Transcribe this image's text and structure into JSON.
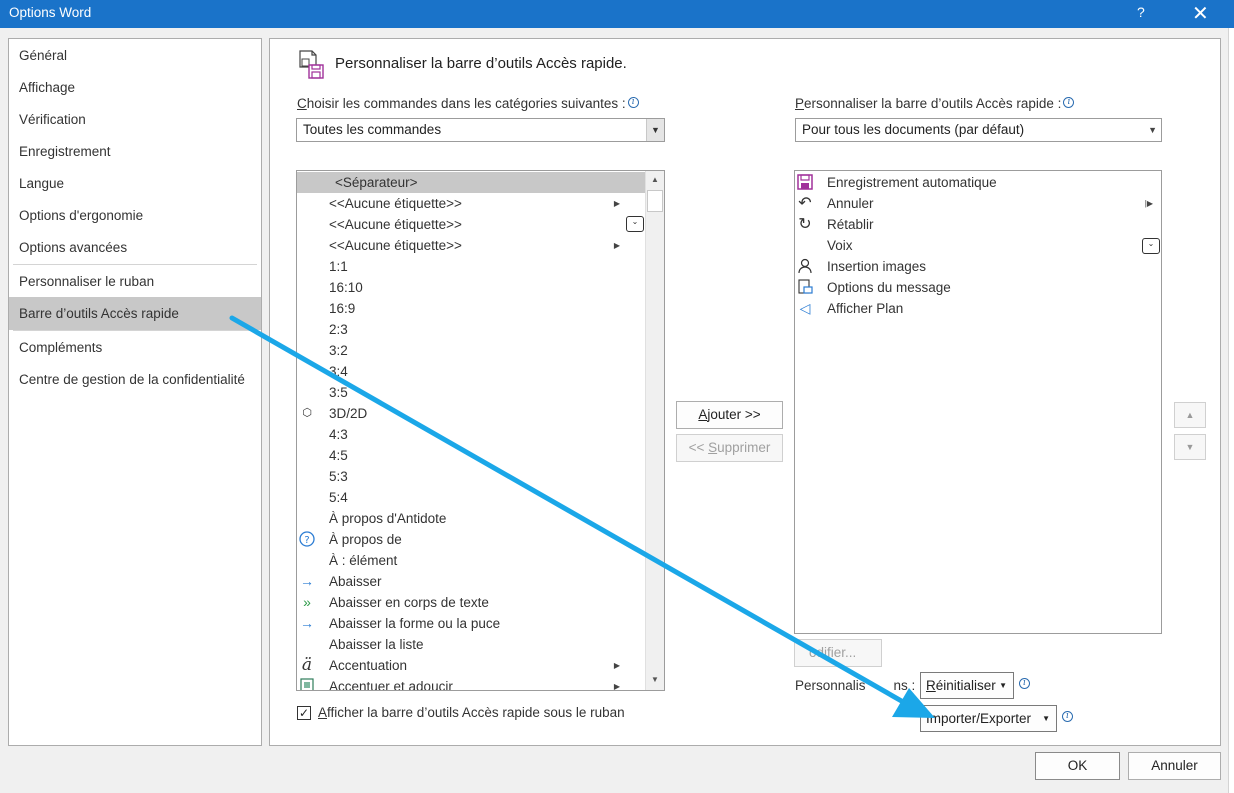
{
  "window": {
    "title": "Options Word",
    "help_glyph": "?",
    "close_glyph": "✕"
  },
  "nav": {
    "items": [
      {
        "label": "Général"
      },
      {
        "label": "Affichage"
      },
      {
        "label": "Vérification"
      },
      {
        "label": "Enregistrement"
      },
      {
        "label": "Langue"
      },
      {
        "label": "Options d'ergonomie"
      },
      {
        "label": "Options avancées"
      },
      {
        "label": "Personnaliser le ruban"
      },
      {
        "label": "Barre d’outils Accès rapide",
        "selected": true
      },
      {
        "label": "Compléments"
      },
      {
        "label": "Centre de gestion de la confidentialité"
      }
    ]
  },
  "header": {
    "title": "Personnaliser la barre d’outils Accès rapide.",
    "icon": "quick-access-toolbar-icon"
  },
  "left": {
    "choose_label": "Choisir les commandes dans les catégories suivantes :",
    "choose_label_accel": "C",
    "choose_label_rest": "hoisir les commandes dans les catégories suivantes :",
    "category_value": "Toutes les commandes",
    "commands": [
      {
        "label": "<Séparateur>",
        "selected": true,
        "icon": ""
      },
      {
        "label": "<<Aucune étiquette>>",
        "submenu": true
      },
      {
        "label": "<<Aucune étiquette>>",
        "badge": true
      },
      {
        "label": "<<Aucune étiquette>>",
        "submenu": true
      },
      {
        "label": "1:1"
      },
      {
        "label": "16:10"
      },
      {
        "label": "16:9"
      },
      {
        "label": "2:3"
      },
      {
        "label": "3:2"
      },
      {
        "label": "3:4"
      },
      {
        "label": "3:5"
      },
      {
        "label": "3D/2D",
        "icon": "3d-2d-icon"
      },
      {
        "label": "4:3"
      },
      {
        "label": "4:5"
      },
      {
        "label": "5:3"
      },
      {
        "label": "5:4"
      },
      {
        "label": "À propos d'Antidote"
      },
      {
        "label": "À propos de",
        "icon": "help-circle-icon"
      },
      {
        "label": "À : élément"
      },
      {
        "label": "Abaisser",
        "icon": "arrow-right-icon"
      },
      {
        "label": "Abaisser en corps de texte",
        "icon": "double-arrow-right-icon"
      },
      {
        "label": "Abaisser la forme ou la puce",
        "icon": "arrow-right-icon"
      },
      {
        "label": "Abaisser la liste"
      },
      {
        "label": "Accentuation",
        "icon": "umlaut-a-icon",
        "submenu": true
      },
      {
        "label": "Accentuer et adoucir",
        "icon": "sharpen-icon",
        "submenu": true
      }
    ],
    "show_below_ribbon": {
      "label": "Afficher la barre d’outils Accès rapide sous le ruban",
      "accel": "A",
      "rest": "fficher la barre d’outils Accès rapide sous le ruban",
      "checked": true
    }
  },
  "middle": {
    "add_label": "Ajouter >>",
    "add_accel": "A",
    "add_rest": "jouter >>",
    "remove_label": "<< Supprimer",
    "remove_prefix": "<< ",
    "remove_accel": "S",
    "remove_rest": "upprimer"
  },
  "right": {
    "customize_label": "Personnaliser la barre d’outils Accès rapide :",
    "customize_accel": "P",
    "customize_rest": "ersonnaliser la barre d’outils Accès rapide :",
    "scope_value": "Pour tous les documents (par défaut)",
    "toolbar_items": [
      {
        "label": "Enregistrement automatique",
        "icon": "floppy-disk-icon"
      },
      {
        "label": "Annuler",
        "icon": "undo-icon",
        "submenu": true
      },
      {
        "label": "Rétablir",
        "icon": "redo-icon"
      },
      {
        "label": "Voix",
        "badge": true
      },
      {
        "label": "Insertion images",
        "icon": "person-icon"
      },
      {
        "label": "Options du message",
        "icon": "message-options-icon"
      },
      {
        "label": "Afficher Plan",
        "icon": "plan-icon"
      }
    ],
    "modify_label": "Modifier...",
    "modify_visible": "odifier...",
    "customizations_label": "Personnalisations :",
    "customizations_visible_a": "Personnalis",
    "customizations_visible_b": "ns :",
    "reset_label": "Réinitialiser",
    "reset_accel": "R",
    "reset_rest": "éinitialiser",
    "import_export_label": "Importer/Exporter",
    "import_export_accel": "p",
    "up_glyph": "▲",
    "down_glyph": "▼"
  },
  "footer": {
    "ok_label": "OK",
    "cancel_label": "Annuler"
  },
  "colors": {
    "titlebar": "#1a73c9",
    "arrow": "#1ba7e8",
    "selection": "#c8c8c8"
  }
}
